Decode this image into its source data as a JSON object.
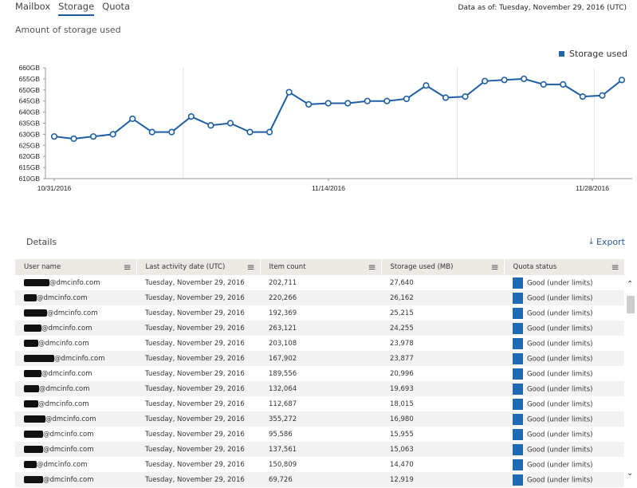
{
  "tabs": [
    {
      "label": "Mailbox",
      "active": false
    },
    {
      "label": "Storage",
      "active": true
    },
    {
      "label": "Quota",
      "active": false
    }
  ],
  "data_as_of": "Data as of: Tuesday, November 29, 2016 (UTC)",
  "section_title": "Amount of storage used",
  "legend": {
    "label": "Storage used",
    "color": "#1e66b0"
  },
  "chart_data": {
    "type": "line",
    "title": "Amount of storage used",
    "xlabel": "",
    "ylabel": "",
    "ylim": [
      610,
      660
    ],
    "y_ticks": [
      "610GB",
      "615GB",
      "620GB",
      "625GB",
      "630GB",
      "635GB",
      "640GB",
      "645GB",
      "650GB",
      "655GB",
      "660GB"
    ],
    "x_tick_labels": [
      {
        "index": 0,
        "label": "10/31/2016"
      },
      {
        "index": 14,
        "label": "11/14/2016"
      },
      {
        "index": 28,
        "label": "11/28/2016"
      }
    ],
    "gridlines_at_index": [
      7,
      21,
      28
    ],
    "legend_position": "top-right",
    "x": [
      "10/31/2016",
      "11/01/2016",
      "11/02/2016",
      "11/03/2016",
      "11/04/2016",
      "11/05/2016",
      "11/06/2016",
      "11/07/2016",
      "11/08/2016",
      "11/09/2016",
      "11/10/2016",
      "11/11/2016",
      "11/12/2016",
      "11/13/2016",
      "11/14/2016",
      "11/15/2016",
      "11/16/2016",
      "11/17/2016",
      "11/18/2016",
      "11/19/2016",
      "11/20/2016",
      "11/21/2016",
      "11/22/2016",
      "11/23/2016",
      "11/24/2016",
      "11/25/2016",
      "11/26/2016",
      "11/27/2016",
      "11/28/2016",
      "11/29/2016"
    ],
    "series": [
      {
        "name": "Storage used",
        "unit": "GB",
        "color": "#1e5fa3",
        "values": [
          629,
          628,
          629,
          630,
          637,
          631,
          631,
          638,
          634,
          635,
          631,
          631,
          649,
          643.5,
          644,
          644,
          645,
          645,
          646,
          652,
          646.5,
          647,
          654,
          654.5,
          655,
          652.5,
          652.5,
          647,
          647.5,
          654.5
        ]
      }
    ]
  },
  "details": {
    "title": "Details",
    "export_label": "Export",
    "columns": [
      "User name",
      "Last activity date (UTC)",
      "Item count",
      "Storage used (MB)",
      "Quota status"
    ],
    "rows": [
      {
        "user_suffix": "@dmcinfo.com",
        "redact": 1.0,
        "last_activity": "Tuesday, November 29, 2016",
        "items": "202,711",
        "storage": "27,640",
        "quota": "Good (under limits)"
      },
      {
        "user_suffix": "@dmcinfo.com",
        "redact": 0.5,
        "last_activity": "Tuesday, November 29, 2016",
        "items": "220,266",
        "storage": "26,162",
        "quota": "Good (under limits)"
      },
      {
        "user_suffix": "@dmcinfo.com",
        "redact": 0.9,
        "last_activity": "Tuesday, November 29, 2016",
        "items": "192,369",
        "storage": "25,215",
        "quota": "Good (under limits)"
      },
      {
        "user_suffix": "@dmcinfo.com",
        "redact": 0.7,
        "last_activity": "Tuesday, November 29, 2016",
        "items": "263,121",
        "storage": "24,255",
        "quota": "Good (under limits)"
      },
      {
        "user_suffix": "@dmcinfo.com",
        "redact": 0.55,
        "last_activity": "Tuesday, November 29, 2016",
        "items": "203,108",
        "storage": "23,978",
        "quota": "Good (under limits)"
      },
      {
        "user_suffix": "@dmcinfo.com",
        "redact": 1.2,
        "last_activity": "Tuesday, November 29, 2016",
        "items": "167,902",
        "storage": "23,877",
        "quota": "Good (under limits)"
      },
      {
        "user_suffix": "@dmcinfo.com",
        "redact": 0.7,
        "last_activity": "Tuesday, November 29, 2016",
        "items": "189,556",
        "storage": "20,996",
        "quota": "Good (under limits)"
      },
      {
        "user_suffix": "@dmcinfo.com",
        "redact": 0.6,
        "last_activity": "Tuesday, November 29, 2016",
        "items": "132,064",
        "storage": "19,693",
        "quota": "Good (under limits)"
      },
      {
        "user_suffix": "@dmcinfo.com",
        "redact": 0.55,
        "last_activity": "Tuesday, November 29, 2016",
        "items": "112,687",
        "storage": "18,015",
        "quota": "Good (under limits)"
      },
      {
        "user_suffix": "@dmcinfo.com",
        "redact": 0.85,
        "last_activity": "Tuesday, November 29, 2016",
        "items": "355,272",
        "storage": "16,980",
        "quota": "Good (under limits)"
      },
      {
        "user_suffix": "@dmcinfo.com",
        "redact": 0.75,
        "last_activity": "Tuesday, November 29, 2016",
        "items": "95,586",
        "storage": "15,955",
        "quota": "Good (under limits)"
      },
      {
        "user_suffix": "@dmcinfo.com",
        "redact": 0.75,
        "last_activity": "Tuesday, November 29, 2016",
        "items": "137,561",
        "storage": "15,063",
        "quota": "Good (under limits)"
      },
      {
        "user_suffix": "@dmcinfo.com",
        "redact": 0.5,
        "last_activity": "Tuesday, November 29, 2016",
        "items": "150,809",
        "storage": "14,470",
        "quota": "Good (under limits)"
      },
      {
        "user_suffix": "@dmcinfo.com",
        "redact": 0.75,
        "last_activity": "Tuesday, November 29, 2016",
        "items": "69,726",
        "storage": "12,919",
        "quota": "Good (under limits)"
      }
    ],
    "quota_color": "#1e6bb5"
  },
  "icons": {
    "column_menu": "≡",
    "export": "⤓",
    "scroll_up": "⌃",
    "scroll_down": "⌄"
  }
}
